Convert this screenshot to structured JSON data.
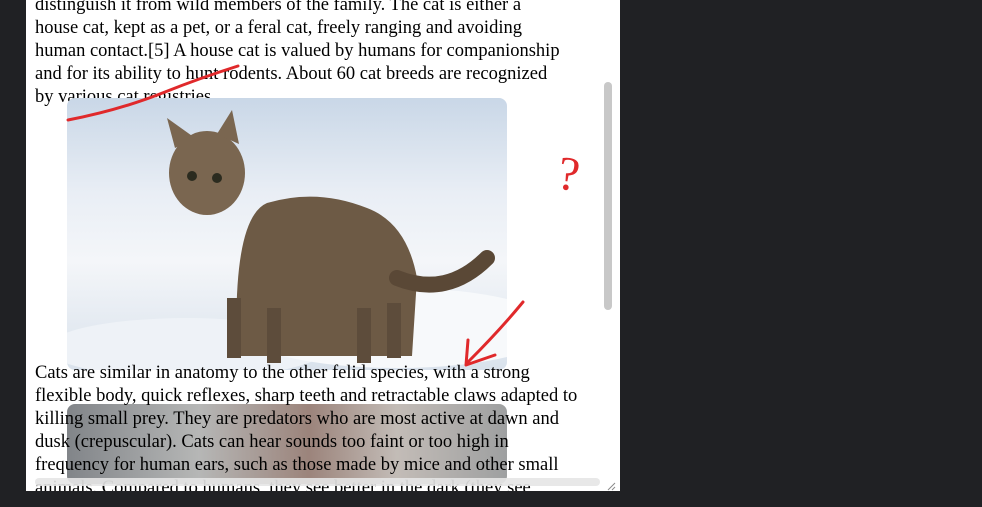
{
  "article": {
    "para1_lines": [
      "distinguish it from wild members of the family. The cat is either a",
      "house cat, kept as a pet, or a feral cat, freely ranging and avoiding",
      "human contact.[5] A house cat is valued by humans for companionship",
      "and for its ability to hunt rodents. About 60 cat breeds are recognized",
      "by various cat registries."
    ],
    "para2_lines": [
      "Cats are similar in anatomy to the other felid species, with a strong",
      "flexible body, quick reflexes, sharp teeth and retractable claws adapted to",
      "killing small prey. They are predators who are most active at dawn and",
      "dusk (crepuscular). Cats can hear sounds too faint or too high in",
      "frequency for human ears, such as those made by mice and other small",
      "animals. Compared to humans, they see better in the dark (they see"
    ]
  },
  "annotations": {
    "question_mark": "?",
    "ink_color": "#e0292b"
  }
}
